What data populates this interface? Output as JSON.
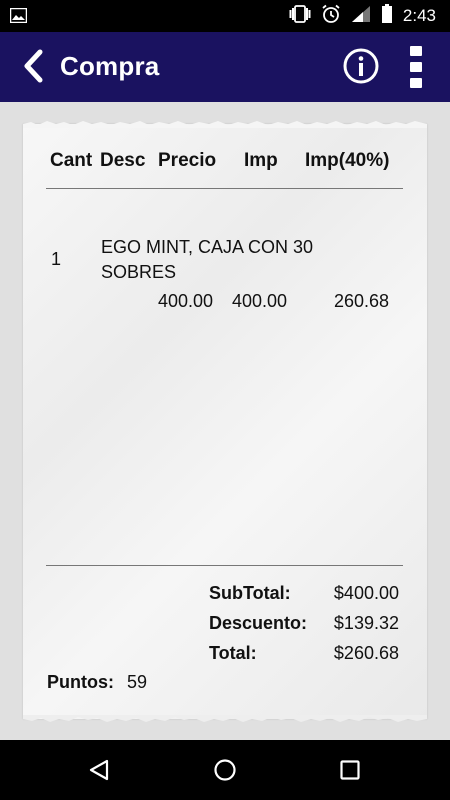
{
  "status_bar": {
    "time": "2:43",
    "icons": [
      "image-icon",
      "vibrate-icon",
      "alarm-icon",
      "signal-icon",
      "battery-icon"
    ]
  },
  "app_bar": {
    "title": "Compra",
    "icons": [
      "back-chevron-icon",
      "info-icon",
      "overflow-menu-icon"
    ],
    "background_color": "#1a1260"
  },
  "receipt": {
    "columns": [
      "Cant",
      "Desc",
      "Precio",
      "Imp",
      "Imp(40%)"
    ],
    "items": [
      {
        "qty": "1",
        "description": "EGO MINT, CAJA CON 30 SOBRES",
        "price": "400.00",
        "amount": "400.00",
        "tax": "260.68"
      }
    ],
    "totals": {
      "subtotal_label": "SubTotal:",
      "subtotal_value": "$400.00",
      "discount_label": "Descuento:",
      "discount_value": "$139.32",
      "total_label": "Total:",
      "total_value": "$260.68"
    },
    "points_label": "Puntos:",
    "points_value": "59"
  },
  "nav_bar": {
    "icons": [
      "back-triangle-icon",
      "home-circle-icon",
      "recents-square-icon"
    ]
  }
}
